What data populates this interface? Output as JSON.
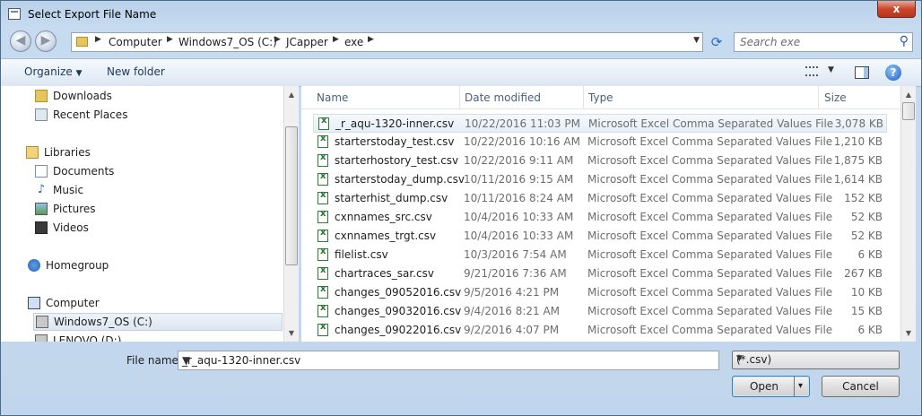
{
  "window": {
    "title": "Select Export File Name",
    "close_label": "x"
  },
  "address": {
    "crumbs": [
      "Computer",
      "Windows7_OS (C:)",
      "JCapper",
      "exe"
    ]
  },
  "search": {
    "placeholder": "Search exe"
  },
  "toolbar": {
    "organize_label": "Organize",
    "new_folder_label": "New folder"
  },
  "nav": {
    "items": [
      {
        "label": "Downloads",
        "icon": "downloads-folder-icon"
      },
      {
        "label": "Recent Places",
        "icon": "recent-places-icon"
      },
      {
        "label": "Libraries",
        "icon": "libraries-icon"
      },
      {
        "label": "Documents",
        "icon": "documents-icon"
      },
      {
        "label": "Music",
        "icon": "music-icon"
      },
      {
        "label": "Pictures",
        "icon": "pictures-icon"
      },
      {
        "label": "Videos",
        "icon": "videos-icon"
      },
      {
        "label": "Homegroup",
        "icon": "homegroup-icon"
      },
      {
        "label": "Computer",
        "icon": "computer-icon"
      },
      {
        "label": "Windows7_OS (C:)",
        "icon": "drive-icon"
      },
      {
        "label": "LENOVO (D:)",
        "icon": "drive-icon"
      }
    ]
  },
  "files": {
    "columns": [
      "Name",
      "Date modified",
      "Type",
      "Size"
    ],
    "rows": [
      {
        "name": "_r_aqu-1320-inner.csv",
        "date": "10/22/2016 11:03 PM",
        "type": "Microsoft Excel Comma Separated Values File",
        "size": "3,078 KB"
      },
      {
        "name": "starterstoday_test.csv",
        "date": "10/22/2016 10:16 AM",
        "type": "Microsoft Excel Comma Separated Values File",
        "size": "1,210 KB"
      },
      {
        "name": "starterhostory_test.csv",
        "date": "10/22/2016 9:11 AM",
        "type": "Microsoft Excel Comma Separated Values File",
        "size": "1,875 KB"
      },
      {
        "name": "starterstoday_dump.csv",
        "date": "10/11/2016 9:15 AM",
        "type": "Microsoft Excel Comma Separated Values File",
        "size": "1,614 KB"
      },
      {
        "name": "starterhist_dump.csv",
        "date": "10/11/2016 8:24 AM",
        "type": "Microsoft Excel Comma Separated Values File",
        "size": "152 KB"
      },
      {
        "name": "cxnnames_src.csv",
        "date": "10/4/2016 10:33 AM",
        "type": "Microsoft Excel Comma Separated Values File",
        "size": "52 KB"
      },
      {
        "name": "cxnnames_trgt.csv",
        "date": "10/4/2016 10:33 AM",
        "type": "Microsoft Excel Comma Separated Values File",
        "size": "52 KB"
      },
      {
        "name": "filelist.csv",
        "date": "10/3/2016 7:54 AM",
        "type": "Microsoft Excel Comma Separated Values File",
        "size": "6 KB"
      },
      {
        "name": "chartraces_sar.csv",
        "date": "9/21/2016 7:36 AM",
        "type": "Microsoft Excel Comma Separated Values File",
        "size": "267 KB"
      },
      {
        "name": "changes_09052016.csv",
        "date": "9/5/2016 4:21 PM",
        "type": "Microsoft Excel Comma Separated Values File",
        "size": "10 KB"
      },
      {
        "name": "changes_09032016.csv",
        "date": "9/4/2016 8:21 AM",
        "type": "Microsoft Excel Comma Separated Values File",
        "size": "15 KB"
      },
      {
        "name": "changes_09022016.csv",
        "date": "9/2/2016 4:07 PM",
        "type": "Microsoft Excel Comma Separated Values File",
        "size": "6 KB"
      }
    ]
  },
  "footer": {
    "file_name_label": "File name:",
    "file_name_value": "_r_aqu-1320-inner.csv",
    "filter_value": "(*.csv)",
    "open_label": "Open",
    "cancel_label": "Cancel"
  }
}
